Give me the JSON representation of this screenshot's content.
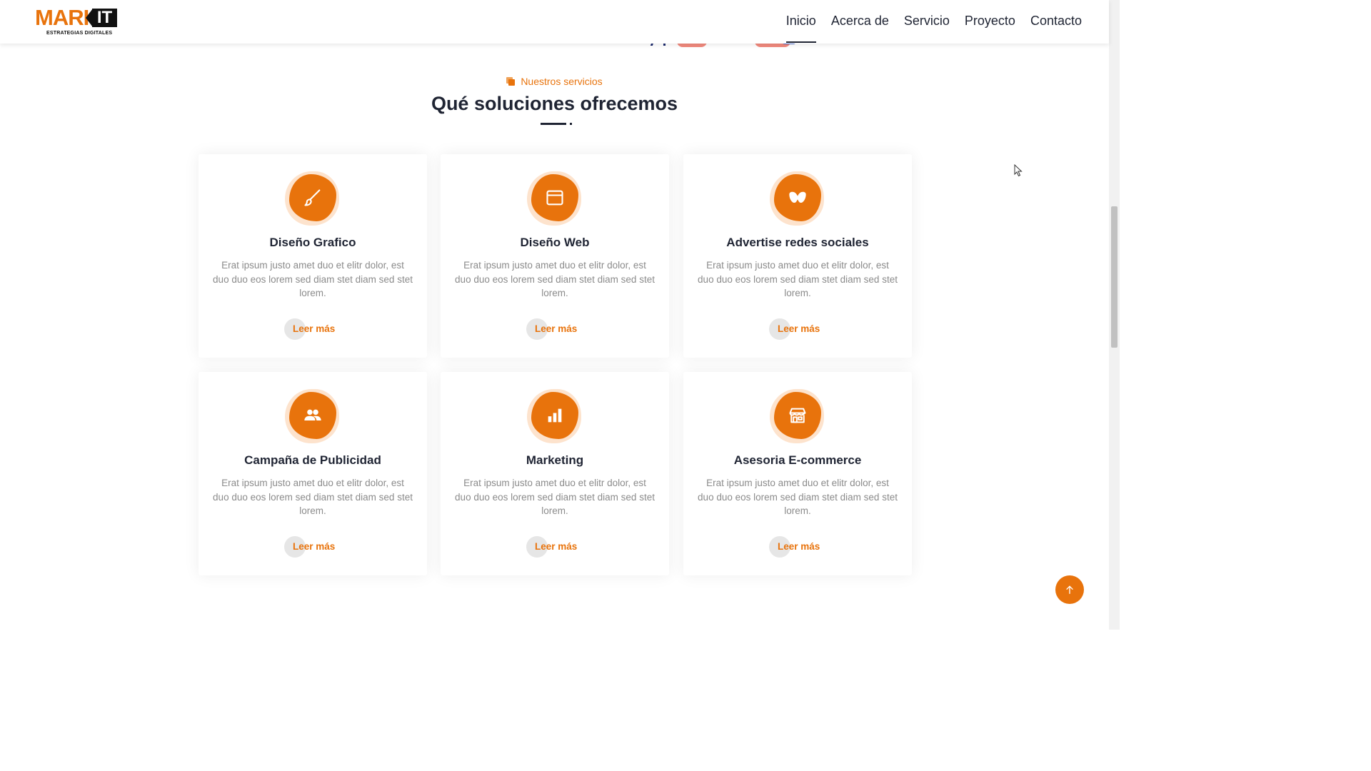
{
  "brand": {
    "logo_main": "MARK",
    "logo_it": "IT",
    "logo_sub": "ESTRATEGIAS DIGITALES"
  },
  "nav": {
    "items": [
      {
        "label": "Inicio",
        "active": true
      },
      {
        "label": "Acerca de",
        "active": false
      },
      {
        "label": "Servicio",
        "active": false
      },
      {
        "label": "Proyecto",
        "active": false
      },
      {
        "label": "Contacto",
        "active": false
      }
    ]
  },
  "services": {
    "tag": "Nuestros servicios",
    "title": "Qué soluciones ofrecemos",
    "cards": [
      {
        "icon": "brush-icon",
        "title": "Diseño Grafico",
        "text": "Erat ipsum justo amet duo et elitr dolor, est duo duo eos lorem sed diam stet diam sed stet lorem.",
        "cta": "Leer más"
      },
      {
        "icon": "browser-window-icon",
        "title": "Diseño Web",
        "text": "Erat ipsum justo amet duo et elitr dolor, est duo duo eos lorem sed diam stet diam sed stet lorem.",
        "cta": "Leer más"
      },
      {
        "icon": "mask-icon",
        "title": "Advertise redes sociales",
        "text": "Erat ipsum justo amet duo et elitr dolor, est duo duo eos lorem sed diam stet diam sed stet lorem.",
        "cta": "Leer más"
      },
      {
        "icon": "users-icon",
        "title": "Campaña de Publicidad",
        "text": "Erat ipsum justo amet duo et elitr dolor, est duo duo eos lorem sed diam stet diam sed stet lorem.",
        "cta": "Leer más"
      },
      {
        "icon": "bar-chart-icon",
        "title": "Marketing",
        "text": "Erat ipsum justo amet duo et elitr dolor, est duo duo eos lorem sed diam stet diam sed stet lorem.",
        "cta": "Leer más"
      },
      {
        "icon": "store-icon",
        "title": "Asesoria E-commerce",
        "text": "Erat ipsum justo amet duo et elitr dolor, est duo duo eos lorem sed diam stet diam sed stet lorem.",
        "cta": "Leer más"
      }
    ]
  },
  "colors": {
    "accent": "#e8730c",
    "accent_light": "#fde3cd",
    "text_dark": "#1f2433",
    "text_muted": "#8b8b8b"
  },
  "scroll_top": {
    "icon": "arrow-up-icon"
  }
}
